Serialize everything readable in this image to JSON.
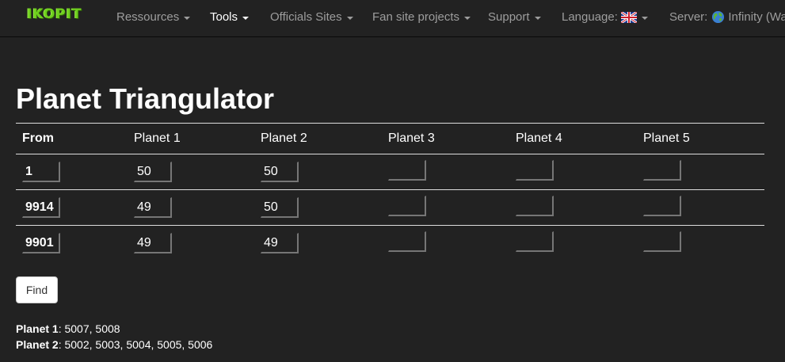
{
  "navbar": {
    "brand": "IKOPIT",
    "items": [
      {
        "label": "Ressources",
        "dropdown": true,
        "active": false
      },
      {
        "label": "Tools",
        "dropdown": true,
        "active": true
      },
      {
        "label": "Officials Sites",
        "dropdown": true,
        "active": false
      },
      {
        "label": "Fan site projects",
        "dropdown": true,
        "active": false
      },
      {
        "label": "Support",
        "dropdown": true,
        "active": false
      }
    ],
    "language": {
      "label": "Language:",
      "flag": "uk-flag-icon"
    },
    "server": {
      "label": "Server:",
      "icon": "globe-icon",
      "value": "Infinity (War"
    }
  },
  "page": {
    "title": "Planet Triangulator"
  },
  "table": {
    "headers": [
      "From",
      "Planet 1",
      "Planet 2",
      "Planet 3",
      "Planet 4",
      "Planet 5"
    ],
    "rows": [
      {
        "from": "1",
        "planets": [
          "50",
          "50",
          "",
          "",
          ""
        ]
      },
      {
        "from": "9914",
        "planets": [
          "49",
          "50",
          "",
          "",
          ""
        ]
      },
      {
        "from": "9901",
        "planets": [
          "49",
          "49",
          "",
          "",
          ""
        ]
      }
    ]
  },
  "find_button": "Find",
  "results": [
    {
      "label": "Planet 1",
      "value": ": 5007, 5008"
    },
    {
      "label": "Planet 2",
      "value": ": 5002, 5003, 5004, 5005, 5006"
    }
  ],
  "colors": {
    "background": "#222222",
    "nav_text": "#9d9d9d",
    "nav_active": "#ffffff",
    "brand": "#6fcf1e"
  }
}
